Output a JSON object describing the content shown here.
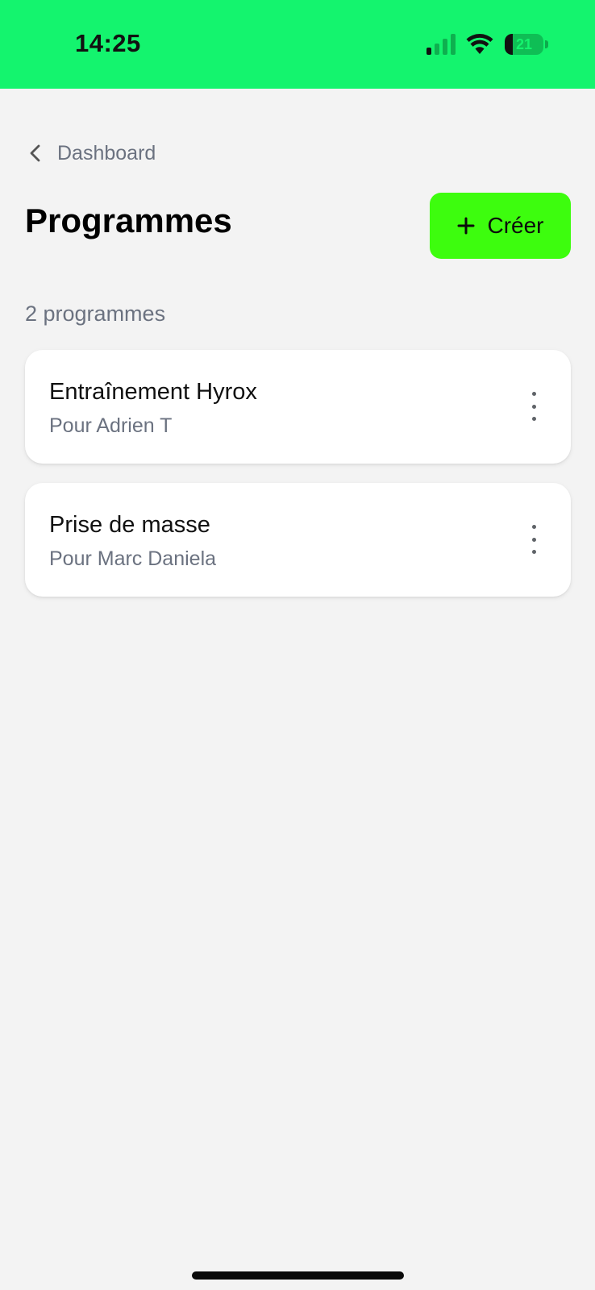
{
  "status_bar": {
    "time": "14:25",
    "battery_level": "21",
    "battery_fraction": 0.21,
    "background_color": "#14f46e",
    "icons": [
      "signal-icon",
      "wifi-icon",
      "battery-icon"
    ]
  },
  "nav": {
    "back_label": "Dashboard",
    "back_icon": "chevron-left-icon"
  },
  "header": {
    "title": "Programmes",
    "create_label": "Créer",
    "create_icon": "plus-icon",
    "accent_color": "#3dfd0e"
  },
  "programmes": {
    "count_label": "2 programmes",
    "items": [
      {
        "title": "Entraînement Hyrox",
        "subtitle": "Pour Adrien T"
      },
      {
        "title": "Prise de masse",
        "subtitle": "Pour Marc Daniela"
      }
    ]
  }
}
